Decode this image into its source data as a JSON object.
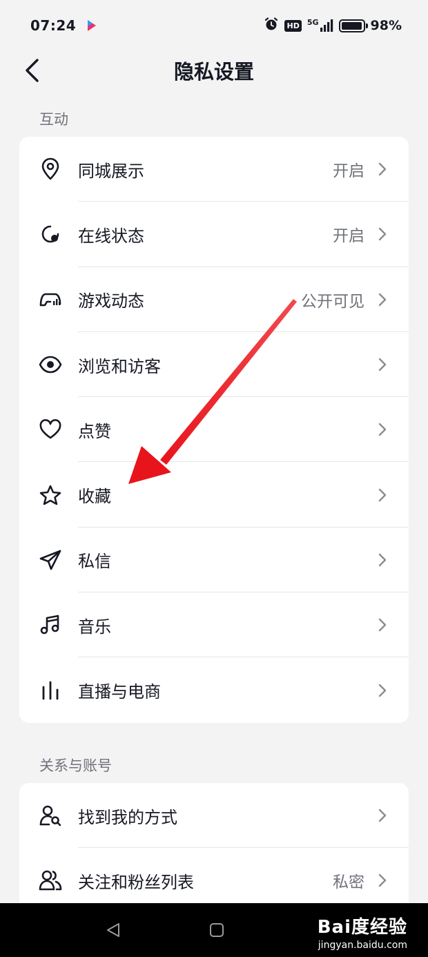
{
  "status_bar": {
    "time": "07:24",
    "network": "5G",
    "hd": "HD",
    "battery_text": "98%",
    "battery_level": 0.98
  },
  "header": {
    "title": "隐私设置",
    "back_icon": "back-arrow-icon"
  },
  "sections": [
    {
      "label": "互动",
      "items": [
        {
          "label": "同城展示",
          "value": "开启",
          "icon": "location-pin-icon"
        },
        {
          "label": "在线状态",
          "value": "开启",
          "icon": "online-status-icon"
        },
        {
          "label": "游戏动态",
          "value": "公开可见",
          "icon": "game-controller-icon"
        },
        {
          "label": "浏览和访客",
          "value": "",
          "icon": "eye-icon"
        },
        {
          "label": "点赞",
          "value": "",
          "icon": "heart-icon"
        },
        {
          "label": "收藏",
          "value": "",
          "icon": "star-icon"
        },
        {
          "label": "私信",
          "value": "",
          "icon": "paper-plane-icon"
        },
        {
          "label": "音乐",
          "value": "",
          "icon": "music-note-icon"
        },
        {
          "label": "直播与电商",
          "value": "",
          "icon": "live-bars-icon"
        }
      ]
    },
    {
      "label": "关系与账号",
      "items": [
        {
          "label": "找到我的方式",
          "value": "",
          "icon": "user-search-icon"
        },
        {
          "label": "关注和粉丝列表",
          "value": "私密",
          "icon": "users-icon"
        }
      ]
    }
  ],
  "annotation": {
    "color": "#e8141b",
    "icon": "red-arrow-icon"
  },
  "watermark": {
    "brand": "Bai度经验",
    "url": "jingyan.baidu.com"
  },
  "colors": {
    "background": "#f3f3f4",
    "card": "#ffffff",
    "text_primary": "#161823",
    "text_secondary": "#70727a"
  }
}
